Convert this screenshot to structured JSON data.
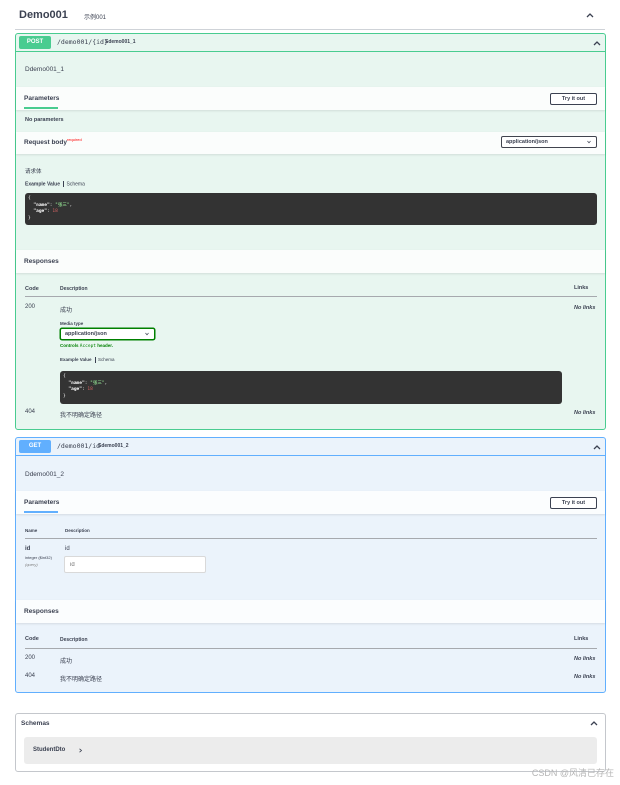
{
  "tag": {
    "name": "Demo001",
    "description": "示例001"
  },
  "post_op": {
    "method": "POST",
    "path": "/demo001/{id}",
    "operation_id": "Sdemo001_1",
    "description": "Ddemo001_1",
    "parameters_label": "Parameters",
    "try_it_out": "Try it out",
    "no_parameters": "No parameters",
    "request_body_label": "Request body",
    "required_label": "required",
    "content_type": "application/json",
    "body_description": "请求体",
    "example_tab": "Example Value",
    "schema_tab": "Schema",
    "example_lines": [
      "{",
      "  \"name\": \"张三\",",
      "  \"age\": 18",
      "}"
    ],
    "responses_label": "Responses",
    "columns": {
      "code": "Code",
      "description": "Description",
      "links": "Links"
    },
    "responses": [
      {
        "code": "200",
        "description": "成功",
        "links": "No links"
      },
      {
        "code": "404",
        "description": "我不明确定路径",
        "links": "No links"
      }
    ],
    "media_type_label": "Media type",
    "media_type_value": "application/json",
    "controls_note": {
      "prefix": "Controls",
      "middle": "Accept",
      "suffix": "header."
    }
  },
  "get_op": {
    "method": "GET",
    "path": "/demo001/id",
    "operation_id": "Sdemo001_2",
    "description": "Ddemo001_2",
    "parameters_label": "Parameters",
    "try_it_out": "Try it out",
    "param_columns": {
      "name": "Name",
      "description": "Description"
    },
    "param": {
      "name": "id",
      "type": "integer ($int32)",
      "location": "(query)",
      "description": "id",
      "placeholder": "id"
    },
    "responses_label": "Responses",
    "columns": {
      "code": "Code",
      "description": "Description",
      "links": "Links"
    },
    "responses": [
      {
        "code": "200",
        "description": "成功",
        "links": "No links"
      },
      {
        "code": "404",
        "description": "我不明确定路径",
        "links": "No links"
      }
    ]
  },
  "schemas": {
    "title": "Schemas",
    "models": [
      "StudentDto"
    ]
  },
  "watermark": "CSDN @风清已存在",
  "colors": {
    "post": "#49cc90",
    "get": "#61affe",
    "text": "#3b4151"
  }
}
